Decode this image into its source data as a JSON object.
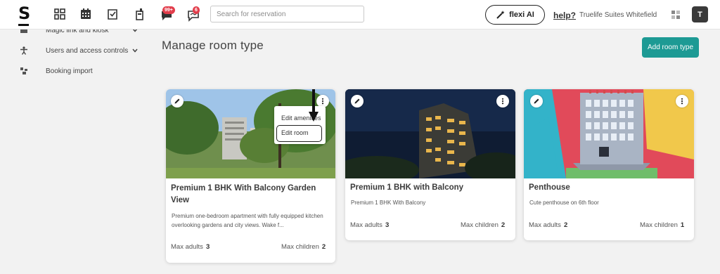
{
  "topbar": {
    "logo": "S",
    "notifications_badge": "99+",
    "messages_badge": "6",
    "search_placeholder": "Search for reservation",
    "flexi_label": "flexi AI",
    "help_label": "help?",
    "property_name": "Truelife Suites Whitefield",
    "avatar_initial": "T",
    "accent_badge_color": "#e23d4b"
  },
  "sidebar": {
    "items": [
      {
        "label": "Magic link and kiosk",
        "icon": "kiosk-icon"
      },
      {
        "label": "Users and access controls",
        "icon": "user-icon"
      },
      {
        "label": "Booking import",
        "icon": "import-icon"
      }
    ]
  },
  "main": {
    "title": "Manage room type",
    "add_button": "Add room type",
    "accent_color": "#1d9a94",
    "context_menu": {
      "items": [
        "Edit amenities",
        "Edit room"
      ],
      "highlighted": "Edit room"
    },
    "cards": [
      {
        "title": "Premium 1 BHK With Balcony Garden View",
        "description": "Premium one-bedroom apartment with fully equipped kitchen overlooking gardens and city views. Wake f...",
        "max_adults_label": "Max adults",
        "max_adults": "3",
        "max_children_label": "Max children",
        "max_children": "2"
      },
      {
        "title": "Premium 1 BHK with Balcony",
        "description": "Premium 1 BHK With Balcony",
        "max_adults_label": "Max adults",
        "max_adults": "3",
        "max_children_label": "Max children",
        "max_children": "2"
      },
      {
        "title": "Penthouse",
        "description": "Cute penthouse on 6th floor",
        "max_adults_label": "Max adults",
        "max_adults": "2",
        "max_children_label": "Max children",
        "max_children": "1"
      }
    ]
  }
}
